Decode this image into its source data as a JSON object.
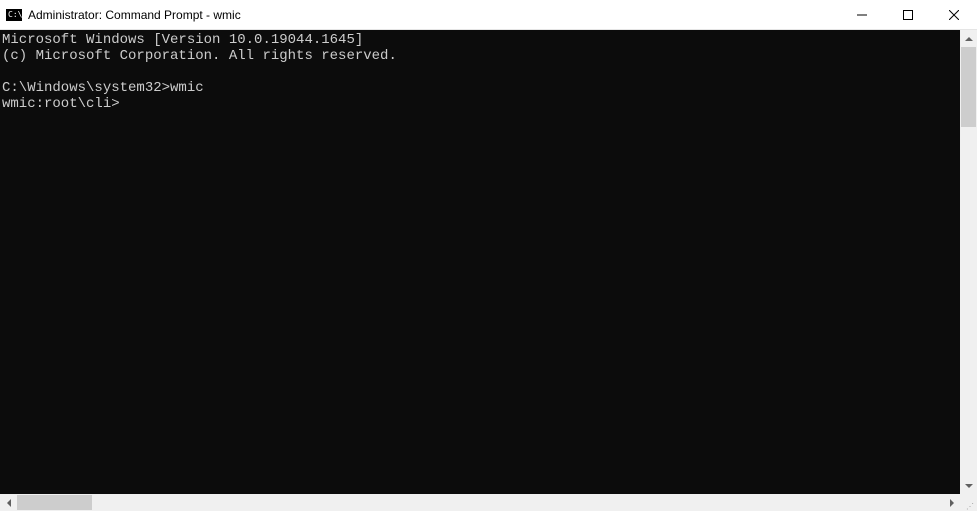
{
  "window": {
    "title": "Administrator: Command Prompt - wmic"
  },
  "console": {
    "lines": [
      "Microsoft Windows [Version 10.0.19044.1645]",
      "(c) Microsoft Corporation. All rights reserved.",
      "",
      "C:\\Windows\\system32>wmic",
      "wmic:root\\cli>"
    ]
  }
}
